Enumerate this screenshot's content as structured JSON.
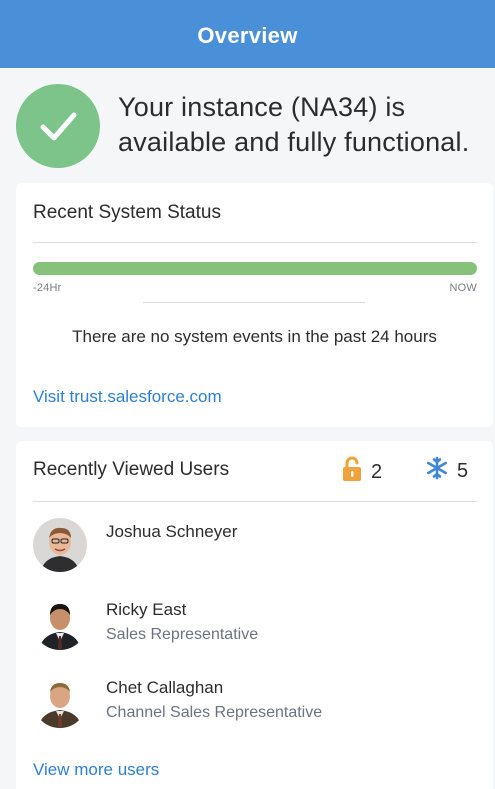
{
  "header": {
    "title": "Overview"
  },
  "instance_status": {
    "line1": "Your instance (NA34) is",
    "line2": "available and fully functional.",
    "icon": "check-icon",
    "color": "#7cc48a"
  },
  "system_status": {
    "title": "Recent System Status",
    "timeline_start": "-24Hr",
    "timeline_end": "NOW",
    "bar_color": "#86c27a",
    "message": "There are no system events in the past 24 hours",
    "link": "Visit trust.salesforce.com"
  },
  "recent_users": {
    "title": "Recently Viewed Users",
    "locked_icon": "lock-icon",
    "locked_count": "2",
    "frozen_icon": "snowflake-icon",
    "frozen_count": "5",
    "users": [
      {
        "name": "Joshua Schneyer",
        "role": ""
      },
      {
        "name": "Ricky East",
        "role": "Sales Representative"
      },
      {
        "name": "Chet Callaghan",
        "role": "Channel Sales Representative"
      }
    ],
    "more_link": "View more users"
  }
}
